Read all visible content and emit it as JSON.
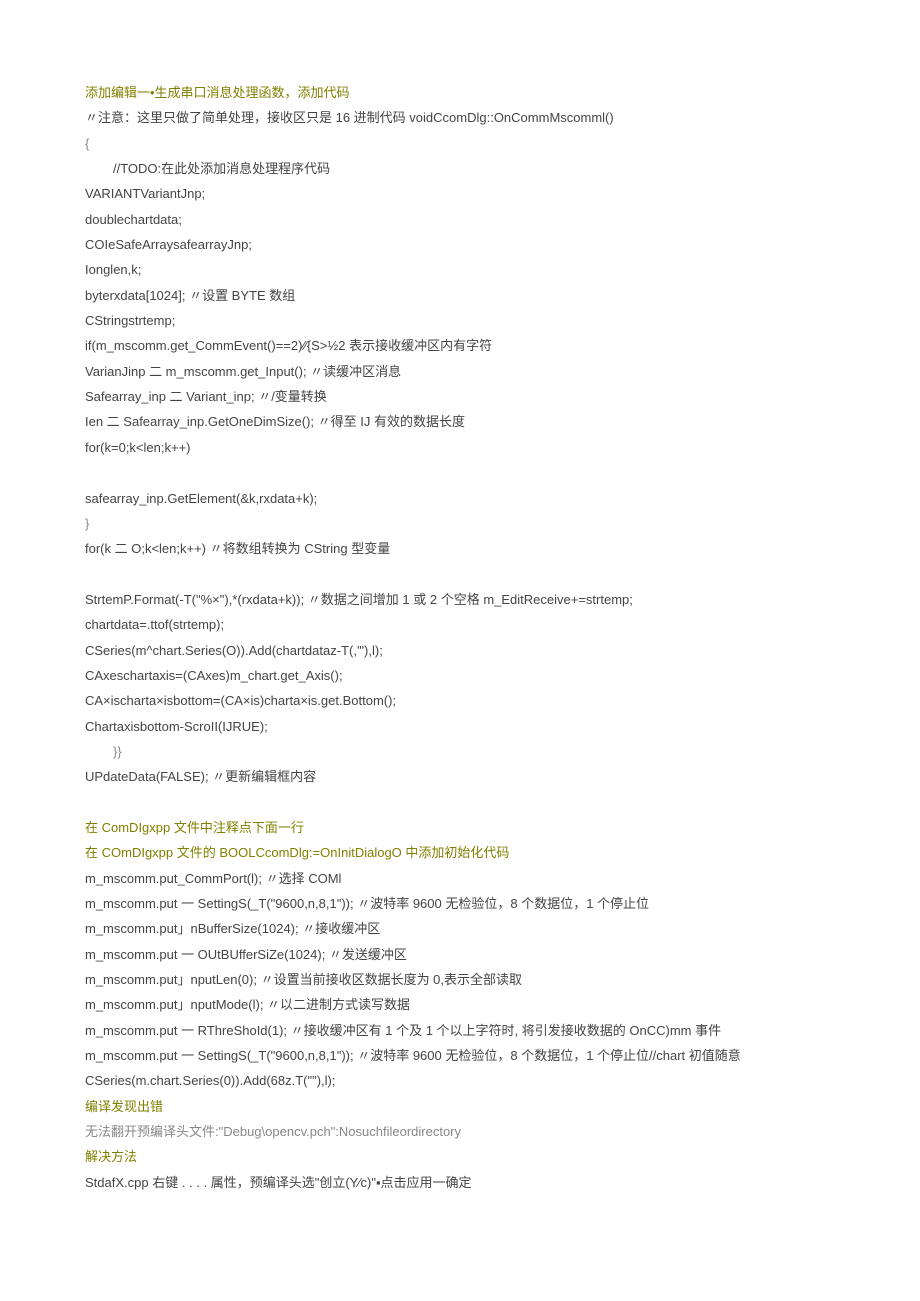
{
  "lines": [
    {
      "cls": "olive",
      "text": "添加编辑一•生成串口消息处理函数，添加代码"
    },
    {
      "cls": "dark",
      "text": "〃注意：这里只做了简单处理，接收区只是 16 进制代码 voidCcomDlg::OnCommMscomml()"
    },
    {
      "cls": "gray",
      "text": "{"
    },
    {
      "cls": "dark indent",
      "text": "//TODO:在此处添加消息处理程序代码"
    },
    {
      "cls": "dark",
      "text": "VARIANTVariantJnp;"
    },
    {
      "cls": "dark",
      "text": "doublechartdata;"
    },
    {
      "cls": "dark",
      "text": "COIeSafeArraysafearrayJnp;"
    },
    {
      "cls": "dark",
      "text": "Ionglen,k;"
    },
    {
      "cls": "dark",
      "text": "byterxdata[1024]; 〃设置 BYTE 数组"
    },
    {
      "cls": "dark",
      "text": "CStringstrtemp;"
    },
    {
      "cls": "dark",
      "text": "if(m_mscomm.get_CommEvent()==2)∕∕{S>½2 表示接收缓冲区内有字符"
    },
    {
      "cls": "dark",
      "text": "VarianJinp 二 m_mscomm.get_Input(); 〃读缓冲区消息"
    },
    {
      "cls": "dark",
      "text": "Safearray_inp 二 Variant_inp; 〃/变量转换"
    },
    {
      "cls": "dark",
      "text": "Ien 二 Safearray_inp.GetOneDimSize(); 〃得至 IJ 有效的数据长度"
    },
    {
      "cls": "dark",
      "text": "for(k=0;k<len;k++)"
    },
    {
      "cls": "gray",
      "text": " "
    },
    {
      "cls": "dark",
      "text": "safearray_inp.GetElement(&k,rxdata+k);"
    },
    {
      "cls": "gray",
      "text": "}"
    },
    {
      "cls": "dark",
      "text": "for(k 二 O;k<len;k++) 〃将数组转换为 CString 型变量"
    },
    {
      "cls": "gray",
      "text": " "
    },
    {
      "cls": "dark",
      "text": "StrtemP.Format(-T(\"%×\"),*(rxdata+k)); 〃数据之间增加 1 或 2 个空格 m_EditReceive+=strtemp;"
    },
    {
      "cls": "dark",
      "text": "chartdata=.ttof(strtemp);"
    },
    {
      "cls": "dark",
      "text": "CSeries(m^chart.Series(O)).Add(chartdataz-T(,'\"),l);"
    },
    {
      "cls": "dark",
      "text": "CAxeschartaxis=(CAxes)m_chart.get_Axis();"
    },
    {
      "cls": "dark",
      "text": "CA×ischarta×isbottom=(CA×is)charta×is.get.Bottom();"
    },
    {
      "cls": "dark",
      "text": "Chartaxisbottom-ScroII(IJRUE);"
    },
    {
      "cls": "gray indent",
      "text": "}}"
    },
    {
      "cls": "dark",
      "text": "UPdateData(FALSE); 〃更新编辑框内容"
    },
    {
      "cls": "gray",
      "text": " "
    },
    {
      "cls": "olive",
      "text": "在 ComDIgxpp 文件中注释点下面一行"
    },
    {
      "cls": "olive",
      "text": "在 COmDIgxpp 文件的 BOOLCcomDlg:=OnInitDialogO 中添加初始化代码"
    },
    {
      "cls": "dark",
      "text": "m_mscomm.put_CommPort(l); 〃选择 COMl"
    },
    {
      "cls": "dark",
      "text": "m_mscomm.put 一 SettingS(_T(\"9600,n,8,1\")); 〃波特率 9600 无检验位，8 个数据位，1 个停止位"
    },
    {
      "cls": "dark",
      "text": "m_mscomm.put」nBufferSize(1024); 〃接收缓冲区"
    },
    {
      "cls": "dark",
      "text": "m_mscomm.put 一 OUtBUfferSiZe(1024); 〃发送缓冲区"
    },
    {
      "cls": "dark",
      "text": "m_mscomm.put」nputLen(0); 〃设置当前接收区数据长度为 0,表示全部读取"
    },
    {
      "cls": "dark",
      "text": "m_mscomm.put」nputMode(l); 〃以二进制方式读写数据"
    },
    {
      "cls": "dark",
      "text": "m_mscomm.put 一 RThreShoId(1); 〃接收缓冲区有 1 个及 1 个以上字符时, 将引发接收数据的 OnCC)mm 事件"
    },
    {
      "cls": "dark",
      "text": "m_mscomm.put 一 SettingS(_T(\"9600,n,8,1\")); 〃波特率 9600 无检验位，8 个数据位，1 个停止位//chart 初值随意"
    },
    {
      "cls": "dark",
      "text": "CSeries(m.chart.Series(0)).Add(68z.T(\"\"),l);"
    },
    {
      "cls": "olive",
      "text": "编译发现出错"
    },
    {
      "cls": "gray",
      "text": "无法翻开预编译头文件:\"Debug\\opencv.pch\":Nosuchfileordirectory"
    },
    {
      "cls": "olive",
      "text": "解决方法"
    },
    {
      "cls": "dark",
      "text": "StdafX.cpp 右键 . . . . 属性，预编译头选\"创立(Y∕c)\"▪点击应用一确定"
    }
  ]
}
